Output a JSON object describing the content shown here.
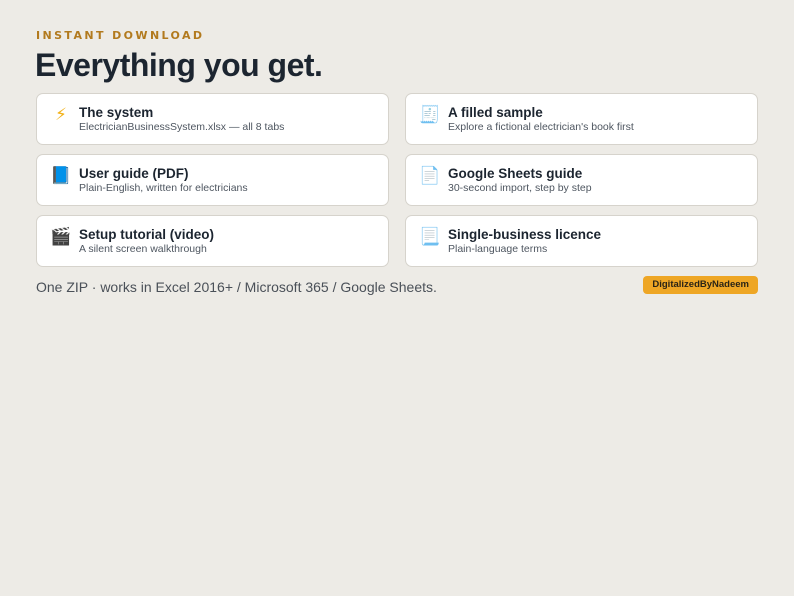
{
  "header": {
    "eyebrow": "INSTANT DOWNLOAD",
    "title": "Everything you get."
  },
  "items": [
    {
      "icon": "lightning-icon",
      "glyph": "⚡",
      "title": "The system",
      "subtitle": "ElectricianBusinessSystem.xlsx — all 8 tabs"
    },
    {
      "icon": "receipt-icon",
      "glyph": "🧾",
      "title": "A filled sample",
      "subtitle": "Explore a fictional electrician's book first"
    },
    {
      "icon": "blue-book-icon",
      "glyph": "📘",
      "title": "User guide (PDF)",
      "subtitle": "Plain-English, written for electricians"
    },
    {
      "icon": "page-icon",
      "glyph": "📄",
      "title": "Google Sheets guide",
      "subtitle": "30-second import, step by step"
    },
    {
      "icon": "clapper-board-icon",
      "glyph": "🎬",
      "title": "Setup tutorial (video)",
      "subtitle": "A silent screen walkthrough"
    },
    {
      "icon": "document-icon",
      "glyph": "📃",
      "title": "Single-business licence",
      "subtitle": "Plain-language terms"
    }
  ],
  "footer": {
    "text": "One ZIP · works in Excel 2016+ / Microsoft 365 / Google Sheets.",
    "badge": "DigitalizedByNadeem"
  },
  "colors": {
    "background": "#edebe6",
    "accent": "#b27a1e",
    "badge": "#eea625",
    "heading": "#1c2530"
  }
}
